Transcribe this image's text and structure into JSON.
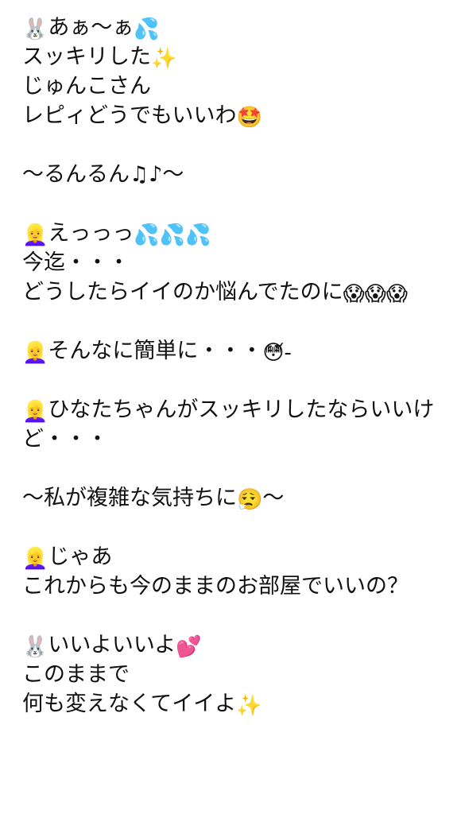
{
  "lines": [
    {
      "emoji_pre": "🐰",
      "text": "あぁ〜ぁ",
      "emoji_post": "💦"
    },
    {
      "emoji_pre": "",
      "text": "スッキリした",
      "emoji_post": "✨"
    },
    {
      "emoji_pre": "",
      "text": "じゅんこさん",
      "emoji_post": ""
    },
    {
      "emoji_pre": "",
      "text": "レピィどうでもいいわ",
      "emoji_post": "🤩"
    },
    {
      "blank": true
    },
    {
      "emoji_pre": "",
      "text": "〜るんるん♫♪〜",
      "emoji_post": ""
    },
    {
      "blank": true
    },
    {
      "emoji_pre": "👱‍♀️",
      "text": "えっっっ",
      "emoji_post": "💦💦💦"
    },
    {
      "emoji_pre": "",
      "text": "今迄・・・",
      "emoji_post": ""
    },
    {
      "emoji_pre": "",
      "text": "どうしたらイイのか悩んでたのに",
      "emoji_post": "😱😱😱",
      "wrap": true
    },
    {
      "blank": true
    },
    {
      "emoji_pre": "👱‍♀️",
      "text": "そんなに簡単に・・・",
      "emoji_post": "😳᷄‐",
      "extra": ""
    },
    {
      "blank": true
    },
    {
      "emoji_pre": "👱‍♀️",
      "text": "ひなたちゃんがスッキリしたならいいけど・・・",
      "emoji_post": "",
      "wrap": true
    },
    {
      "blank": true
    },
    {
      "emoji_pre": "",
      "text": "〜私が複雑な気持ちに",
      "emoji_post": "😮‍💨",
      "tail": "〜"
    },
    {
      "blank": true
    },
    {
      "emoji_pre": "👱‍♀️",
      "text": "じゃあ",
      "emoji_post": ""
    },
    {
      "emoji_pre": "",
      "text": "これからも今のままのお部屋でいいの？",
      "emoji_post": ""
    },
    {
      "blank": true
    },
    {
      "emoji_pre": "🐰",
      "text": "いいよいいよ",
      "emoji_post": "💕"
    },
    {
      "emoji_pre": "",
      "text": "このままで",
      "emoji_post": ""
    },
    {
      "emoji_pre": "",
      "text": "何も変えなくてイイよ",
      "emoji_post": "✨"
    }
  ],
  "icons": {
    "rabbit": "rabbit-face-icon",
    "woman": "blonde-woman-icon",
    "sweat": "sweat-droplets-icon",
    "sparkles": "sparkles-icon",
    "starstruck": "star-struck-face-icon",
    "scream": "screaming-face-icon",
    "flushed": "flushed-face-icon",
    "exhale": "face-exhaling-icon",
    "hearts": "two-hearts-icon"
  }
}
